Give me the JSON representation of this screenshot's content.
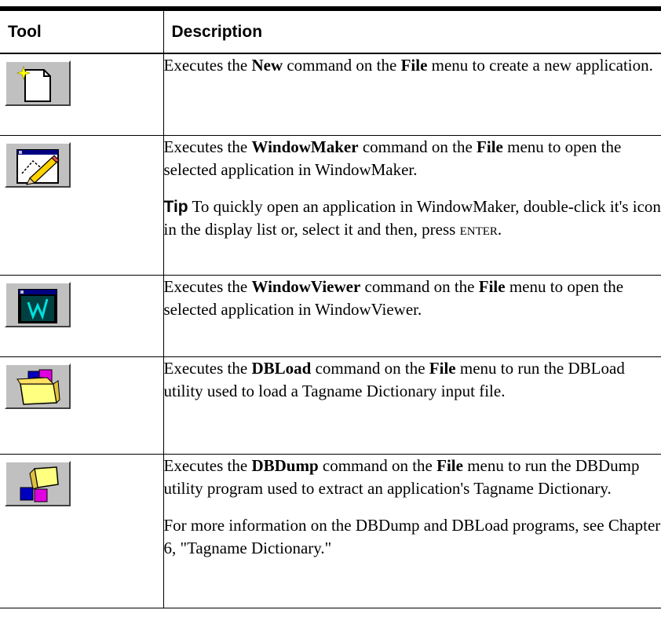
{
  "header": {
    "tool": "Tool",
    "description": "Description"
  },
  "rows": [
    {
      "icon": "new-document-icon",
      "p1": {
        "a": "Executes the ",
        "b": "New",
        "c": " command on the ",
        "d": "File",
        "e": " menu to create a new application."
      }
    },
    {
      "icon": "windowmaker-pencil-icon",
      "p1": {
        "a": "Executes the ",
        "b": "WindowMaker",
        "c": " command on the ",
        "d": "File",
        "e": " menu to open the selected application in WindowMaker."
      },
      "tip": {
        "label": "Tip",
        "text": " To quickly open an application in WindowMaker, double-click it's icon in the display list or, select it and then, press ",
        "key": "ENTER",
        "end": "."
      }
    },
    {
      "icon": "windowviewer-icon",
      "p1": {
        "a": "Executes the ",
        "b": "WindowViewer",
        "c": " command on the ",
        "d": "File",
        "e": " menu to open the selected application in WindowViewer."
      }
    },
    {
      "icon": "dbload-box-icon",
      "p1": {
        "a": "Executes the ",
        "b": "DBLoad",
        "c": " command on the ",
        "d": "File",
        "e": " menu to run the DBLoad utility used to load a Tagname Dictionary input file."
      }
    },
    {
      "icon": "dbdump-box-icon",
      "p1": {
        "a": "Executes the ",
        "b": "DBDump",
        "c": " command on the ",
        "d": "File",
        "e": " menu to run the DBDump utility program used to extract an application's Tagname Dictionary."
      },
      "p2": "For more information on the DBDump and DBLoad programs, see Chapter 6, \"Tagname Dictionary.\""
    }
  ]
}
